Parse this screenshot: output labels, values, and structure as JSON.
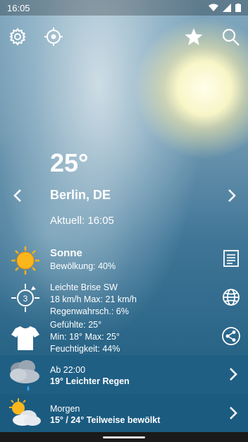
{
  "status": {
    "time": "16:05"
  },
  "current": {
    "temperature": "25°",
    "city": "Berlin, DE",
    "updated": "Aktuell: 16:05"
  },
  "condition": {
    "title": "Sonne",
    "clouds": "Bewölkung: 40%"
  },
  "wind": {
    "description": "Leichte Brise SW",
    "speed": "18 km/h Max: 21 km/h",
    "rain": "Regenwahrsch.: 6%",
    "beaufort": "3"
  },
  "feels": {
    "feels_like": "Gefühlte: 25°",
    "minmax": "Min: 18° Max: 25°",
    "humidity": "Feuchtigkeit: 44%"
  },
  "forecast": [
    {
      "time": "Ab 22:00",
      "summary": "19° Leichter Regen",
      "icon": "cloud-rain-icon"
    },
    {
      "time": "Morgen",
      "summary": "15° / 24° Teilweise bewölkt",
      "icon": "partly-cloudy-icon"
    }
  ],
  "colors": {
    "band1": "#1e5e83",
    "band2": "#1b5d82",
    "sun": "#f7b21a"
  }
}
